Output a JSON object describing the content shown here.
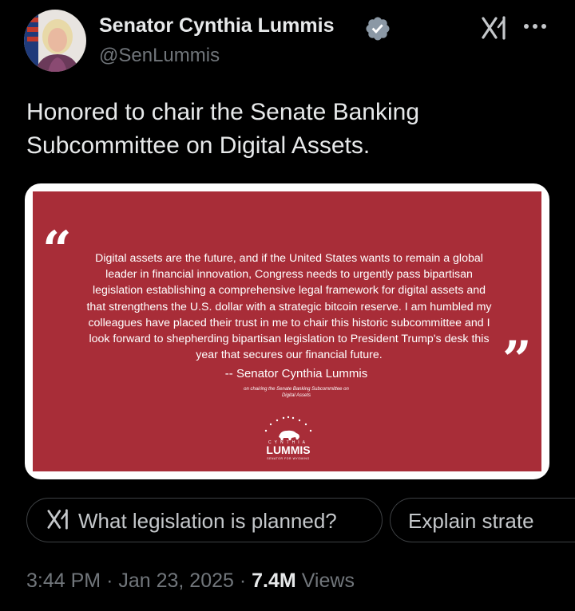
{
  "author": {
    "name": "Senator Cynthia Lummis",
    "handle": "@SenLummis",
    "avatar_icon": "profile-photo",
    "verified_icon": "verified-badge-icon",
    "verified_color": "#8b98a5"
  },
  "header_actions": {
    "grok_icon": "grok-icon",
    "more_icon": "more-dots-icon"
  },
  "tweet": {
    "text_line_1": "Honored to chair the Senate Banking",
    "text_line_2": "Subcommittee on Digital Assets."
  },
  "media": {
    "background_color": "#a82d38",
    "quote_open": "“",
    "quote_close": "”",
    "quote_lines": [
      "Digital assets are the future, and if the United States wants to remain a global",
      "leader in financial innovation, Congress needs to urgently pass bipartisan",
      "legislation establishing a comprehensive legal framework for digital assets and",
      "that strengthens the U.S. dollar with a strategic bitcoin reserve. I am humbled my",
      "colleagues have placed their trust in me to chair this historic subcommittee and I",
      "look forward to shepherding bipartisan legislation to President Trump's desk this",
      "year that secures our financial future."
    ],
    "attribution": "-- Senator Cynthia Lummis",
    "attribution_sub_line_1": "on chairing the Senate Banking Subcommittee on",
    "attribution_sub_line_2": "Digital Assets",
    "logo": {
      "top_text": "CYNTHIA",
      "main_text": "LUMMIS",
      "bottom_text": "SENATOR FOR WYOMING"
    }
  },
  "suggestions": [
    {
      "label": "What legislation is planned?",
      "icon": "grok-icon"
    },
    {
      "label": "Explain strate"
    }
  ],
  "meta": {
    "time": "3:44 PM",
    "separator_1": "·",
    "date": "Jan 23, 2025",
    "separator_2": "·",
    "views_count": "7.4M",
    "views_label": "Views"
  }
}
